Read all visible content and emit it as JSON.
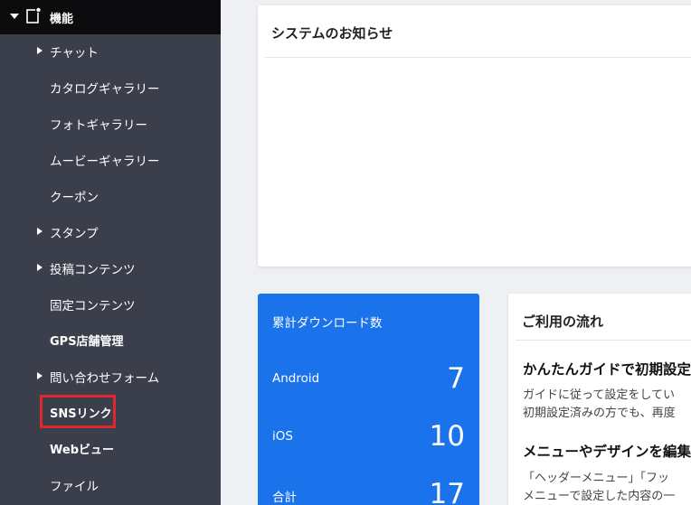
{
  "sidebar": {
    "header": {
      "title": "機能"
    },
    "items": [
      {
        "label": "チャット"
      },
      {
        "label": "カタログギャラリー"
      },
      {
        "label": "フォトギャラリー"
      },
      {
        "label": "ムービーギャラリー"
      },
      {
        "label": "クーポン"
      },
      {
        "label": "スタンプ"
      },
      {
        "label": "投稿コンテンツ"
      },
      {
        "label": "固定コンテンツ"
      },
      {
        "label": "GPS店舗管理"
      },
      {
        "label": "問い合わせフォーム"
      },
      {
        "label": "SNSリンク"
      },
      {
        "label": "Webビュー"
      },
      {
        "label": "ファイル"
      }
    ]
  },
  "notice": {
    "title": "システムのお知らせ"
  },
  "downloads": {
    "title": "累計ダウンロード数",
    "rows": [
      {
        "label": "Android",
        "value": "7"
      },
      {
        "label": "iOS",
        "value": "10"
      },
      {
        "label": "合計",
        "value": "17"
      }
    ]
  },
  "flow": {
    "title": "ご利用の流れ",
    "sections": [
      {
        "heading": "かんたんガイドで初期設定",
        "lines": [
          "ガイドに従って設定をしてい",
          "初期設定済みの方でも、再度"
        ]
      },
      {
        "heading": "メニューやデザインを編集",
        "lines": [
          "「ヘッダーメニュー」「フッ",
          "メニューで設定した内容の一"
        ]
      }
    ]
  },
  "colors": {
    "sidebar": "#3a3f4b",
    "header": "#0c0c0e",
    "accent": "#1a73ea",
    "highlight": "#e0262e"
  }
}
